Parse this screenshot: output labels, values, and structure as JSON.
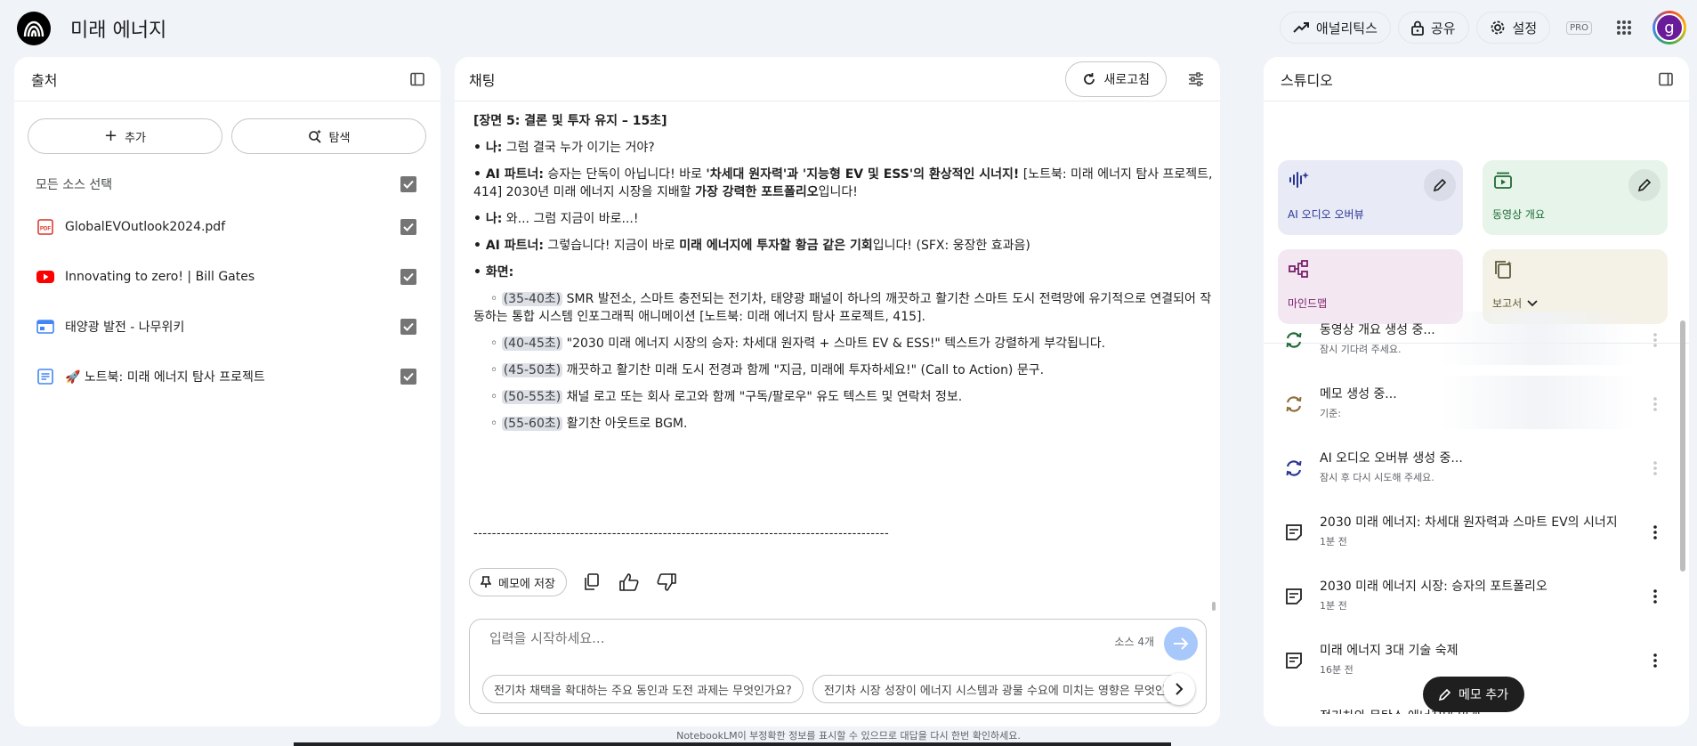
{
  "app": {
    "title": "미래 에너지"
  },
  "topbar": {
    "analytics_label": "애널리틱스",
    "share_label": "공유",
    "settings_label": "설정",
    "pro_badge": "PRO",
    "avatar_letter": "g"
  },
  "sources": {
    "title": "출처",
    "add_label": "추가",
    "explore_label": "탐색",
    "select_all_label": "모든 소스 선택",
    "items": [
      {
        "name": "GlobalEVOutlook2024.pdf",
        "icon": "pdf-icon",
        "checked": true
      },
      {
        "name": "Innovating to zero! | Bill Gates",
        "icon": "youtube-icon",
        "checked": true
      },
      {
        "name": "태양광 발전 - 나무위키",
        "icon": "web-icon",
        "checked": true
      },
      {
        "name": "🚀 노트북: 미래 에너지 탐사 프로젝트",
        "icon": "text-doc-icon",
        "checked": true
      }
    ]
  },
  "chat": {
    "title": "채팅",
    "refresh_label": "새로고침",
    "lines": {
      "l1": "[장면 5: 결론 및 투자 유지 – 15초]",
      "l2_b": "• 나:",
      "l2_t": " 그럼 결국 누가 이기는 거야?",
      "l3_b": "• AI 파트너:",
      "l3_t": " 승자는 단독이 아닙니다! 바로 ",
      "l3_b2": "'차세대 원자력'과 '지능형 EV 및 ESS'의 환상적인 시너지!",
      "l3_t2": " [노트북: 미래 에너지 탐사 프로젝트,",
      "l4_t": "414] 2030년 미래 에너지 시장을 지배할 ",
      "l4_b": "가장 강력한 포트폴리오",
      "l4_t2": "입니다!",
      "l5_b": "• 나:",
      "l5_t": " 와... 그럼 지금이 바로...!",
      "l6_b": "• AI 파트너:",
      "l6_t": " 그렇습니다! 지금이 바로 ",
      "l6_b2": "미래 에너지에 투자할 황금 같은 기회",
      "l6_t2": "입니다! (SFX: 웅장한 효과음)",
      "l7_b": "• 화면:",
      "s1_tag": "(35-40초)",
      "s1_t": " SMR 발전소, 스마트 충전되는 전기차, 태양광 패널이 하나의 깨끗하고 활기찬 스마트 도시 전력망에 유기적으로 연결되어 작",
      "s1_t2": "동하는 통합 시스템 인포그래픽 애니메이션 [노트북: 미래 에너지 탐사 프로젝트, 415].",
      "s2_tag": "(40-45초)",
      "s2_t": " \"2030 미래 에너지 시장의 승자: 차세대 원자력 + 스마트 EV & ESS!\" 텍스트가 강렬하게 부각됩니다.",
      "s3_tag": "(45-50초)",
      "s3_t": " 깨끗하고 활기찬 미래 도시 전경과 함께 \"지금, 미래에 투자하세요!\" (Call to Action) 문구.",
      "s4_tag": "(50-55초)",
      "s4_t": " 채널 로고 또는 회사 로고와 함께 \"구독/팔로우\" 유도 텍스트 및 연락처 정보.",
      "s5_tag": "(55-60초)",
      "s5_t": " 활기찬 아웃트로 BGM.",
      "bullet": "◦",
      "divider": "------------------------------------------------------------------------------------------"
    },
    "save_memo_label": "메모에 저장",
    "input_placeholder": "입력을 시작하세요...",
    "source_count": "소스 4개",
    "suggestions": [
      "전기차 채택을 확대하는 주요 동인과 도전 과제는 무엇인가요?",
      "전기차 시장 성장이 에너지 시스템과 광물 수요에 미치는 영향은 무엇인가요?"
    ]
  },
  "studio": {
    "title": "스튜디오",
    "cards": [
      {
        "label": "AI 오디오 오버뷰",
        "color": "#e8eaf6",
        "text_color": "#283593"
      },
      {
        "label": "동영상 개요",
        "color": "#e6f4ea",
        "text_color": "#1e6b35"
      },
      {
        "label": "마인드맵",
        "color": "#f3e8f1",
        "text_color": "#7b1f6a"
      },
      {
        "label": "보고서",
        "color": "#f4f1e6",
        "text_color": "#5f5a3a"
      }
    ],
    "items": [
      {
        "title": "동영상 개요 생성 중...",
        "sub": "잠시 기다려 주세요."
      },
      {
        "title": "메모 생성 중...",
        "sub": "기준:"
      },
      {
        "title": "AI 오디오 오버뷰 생성 중...",
        "sub": "잠시 후 다시 시도해 주세요."
      },
      {
        "title": "2030 미래 에너지: 차세대 원자력과 스마트 EV의 시너지",
        "sub": "1분 전"
      },
      {
        "title": "2030 미래 에너지 시장: 승자의 포트폴리오",
        "sub": "1분 전"
      },
      {
        "title": "미래 에너지 3대 기술 숙제",
        "sub": "16분 전"
      }
    ],
    "cut_item": "전기차와 문탄소 에너지의 미래",
    "add_memo_label": "메모 추가"
  },
  "footer": {
    "disclaimer": "NotebookLM이 부정확한 정보를 표시할 수 있으므로 대답을 다시 한번 확인하세요."
  }
}
